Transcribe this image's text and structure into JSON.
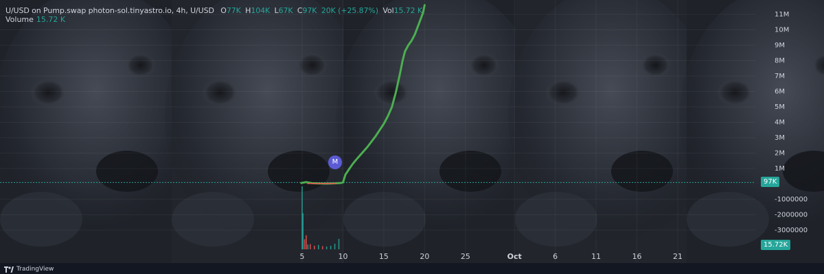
{
  "header": {
    "symbol": "U/USD on Pump.swap photon-sol.tinyastro.io, 4h, U/USD",
    "o_label": "O",
    "o_value": "77K",
    "h_label": "H",
    "h_value": "104K",
    "l_label": "L",
    "l_value": "67K",
    "c_label": "C",
    "c_value": "97K",
    "change": "20K (+25.87%)",
    "vol_label": "Vol",
    "vol_value": "15.72 K"
  },
  "volume_row": {
    "label": "Volume",
    "value": "15.72 K"
  },
  "price_tag": "97K",
  "volume_tag": "15.72K",
  "event_marker": "M",
  "branding": "TradingView",
  "colors": {
    "up": "#4caf50",
    "teal": "#26a69a",
    "down": "#ef5350",
    "text": "#d1d4dc"
  },
  "chart_data": {
    "type": "line",
    "price_axis_ticks": [
      "11M",
      "10M",
      "9M",
      "8M",
      "7M",
      "6M",
      "5M",
      "4M",
      "3M",
      "2M",
      "1M",
      "-1000000",
      "-2000000",
      "-3000000"
    ],
    "price_axis_values": [
      11000000,
      10000000,
      9000000,
      8000000,
      7000000,
      6000000,
      5000000,
      4000000,
      3000000,
      2000000,
      1000000,
      -1000000,
      -2000000,
      -3000000
    ],
    "ylim": [
      -4000000,
      11800000
    ],
    "x_ticks": [
      "5",
      "10",
      "15",
      "20",
      "25",
      "Oct",
      "6",
      "11",
      "16",
      "21"
    ],
    "x_tick_values": [
      5,
      10,
      15,
      20,
      25,
      31,
      36,
      41,
      46,
      51
    ],
    "x_bold_ticks": [
      "Oct"
    ],
    "xlim": [
      -32,
      60.5
    ],
    "series": [
      {
        "x": [
          4.9,
          5.5,
          6.2,
          7.0,
          8.0,
          9.0,
          9.7,
          10.0,
          10.3,
          10.8,
          11.2,
          11.5,
          12.0,
          13.0,
          14.0,
          15.0,
          15.5,
          16.0,
          16.5,
          17.0,
          17.3,
          17.6,
          18.0,
          18.4,
          18.8,
          19.3,
          19.8,
          20.0
        ],
        "y": [
          60000,
          120000,
          50000,
          30000,
          20000,
          40000,
          60000,
          97000,
          600000,
          1000000,
          1300000,
          1500000,
          1800000,
          2400000,
          3100000,
          3900000,
          4400000,
          5000000,
          6000000,
          7200000,
          8000000,
          8600000,
          9000000,
          9300000,
          9700000,
          10400000,
          11100000,
          11600000
        ],
        "color": "#4caf50"
      }
    ],
    "volume": {
      "x": [
        5.0,
        5.1,
        5.3,
        5.5,
        5.7,
        6.0,
        6.5,
        7.0,
        7.5,
        8.0,
        8.5,
        9.0,
        9.5
      ],
      "values": [
        15720,
        9000,
        2500,
        3500,
        1200,
        1300,
        900,
        1100,
        800,
        700,
        900,
        1400,
        2600
      ],
      "colors": [
        "#26a69a",
        "#26a69a",
        "#ef5350",
        "#ef5350",
        "#26a69a",
        "#ef5350",
        "#ef5350",
        "#26a69a",
        "#ef5350",
        "#26a69a",
        "#26a69a",
        "#26a69a",
        "#26a69a"
      ]
    },
    "last_price": 97000,
    "grid": true
  }
}
